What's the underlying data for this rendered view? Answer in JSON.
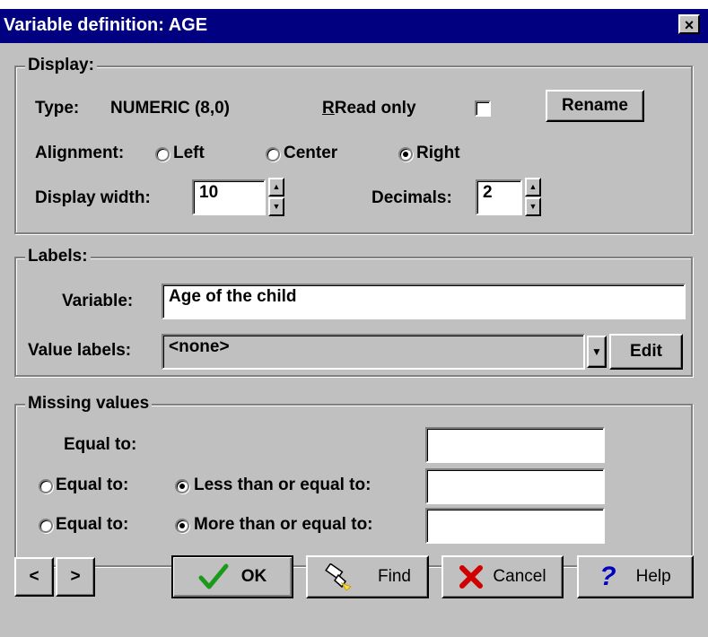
{
  "window": {
    "title": "Variable definition: AGE",
    "close": "×"
  },
  "display": {
    "legend": "Display:",
    "type_label": "Type:",
    "type_value": "NUMERIC (8,0)",
    "read_only_label": "Read only",
    "rename_label": "Rename",
    "alignment_label": "Alignment:",
    "align_left": "Left",
    "align_center": "Center",
    "align_right": "Right",
    "align_selected": "Right",
    "display_width_label": "Display width:",
    "display_width_value": "10",
    "decimals_label": "Decimals:",
    "decimals_value": "2"
  },
  "labels": {
    "legend": "Labels:",
    "variable_label": "Variable:",
    "variable_value": "Age of the child",
    "value_labels_label": "Value labels:",
    "value_labels_value": "<none>",
    "edit_label": "Edit"
  },
  "missing": {
    "legend": "Missing values",
    "equal_to_1": "Equal to:",
    "equal_to_2": "Equal to:",
    "less_than": "Less than or equal to:",
    "equal_to_3": "Equal to:",
    "more_than": "More than or equal to:",
    "field_1": "",
    "field_2": "",
    "field_3": ""
  },
  "buttons": {
    "prev": "<",
    "next": ">",
    "ok": "OK",
    "find": "Find",
    "cancel": "Cancel",
    "help": "Help"
  },
  "icons": {
    "ok": "checkmark-icon",
    "find": "flashlight-icon",
    "cancel": "x-icon",
    "help": "question-mark-icon"
  },
  "colors": {
    "titlebar": "#000080",
    "face": "#c0c0c0",
    "ok_check": "#1a9a1a",
    "cancel_x": "#d00000",
    "help_q": "#0000c0"
  }
}
